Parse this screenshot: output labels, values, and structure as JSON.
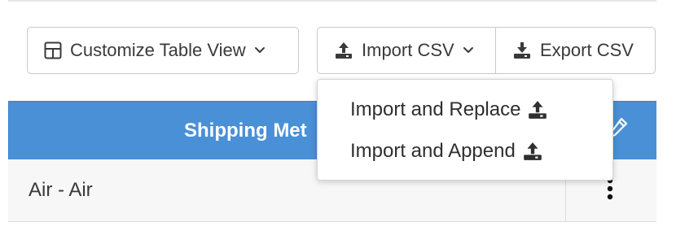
{
  "toolbar": {
    "customize_label": "Customize Table View",
    "import_label": "Import CSV",
    "export_label": "Export CSV"
  },
  "import_menu": {
    "items": [
      {
        "label": "Import and Replace"
      },
      {
        "label": "Import and Append"
      }
    ]
  },
  "table": {
    "header": {
      "visible_label": "Shipping Met"
    },
    "rows": [
      {
        "shipping_method": "Air - Air"
      }
    ]
  },
  "icons": {
    "customize": "table-layout-icon",
    "dropdown_caret": "chevron-down-icon",
    "import": "upload-icon",
    "export": "download-icon",
    "edit": "pencil-icon",
    "row_actions": "kebab-menu-icon"
  },
  "colors": {
    "header_bg": "#4a90d6",
    "header_text": "#ffffff",
    "row_bg": "#f7f7f7",
    "border": "#c9c9c9"
  }
}
